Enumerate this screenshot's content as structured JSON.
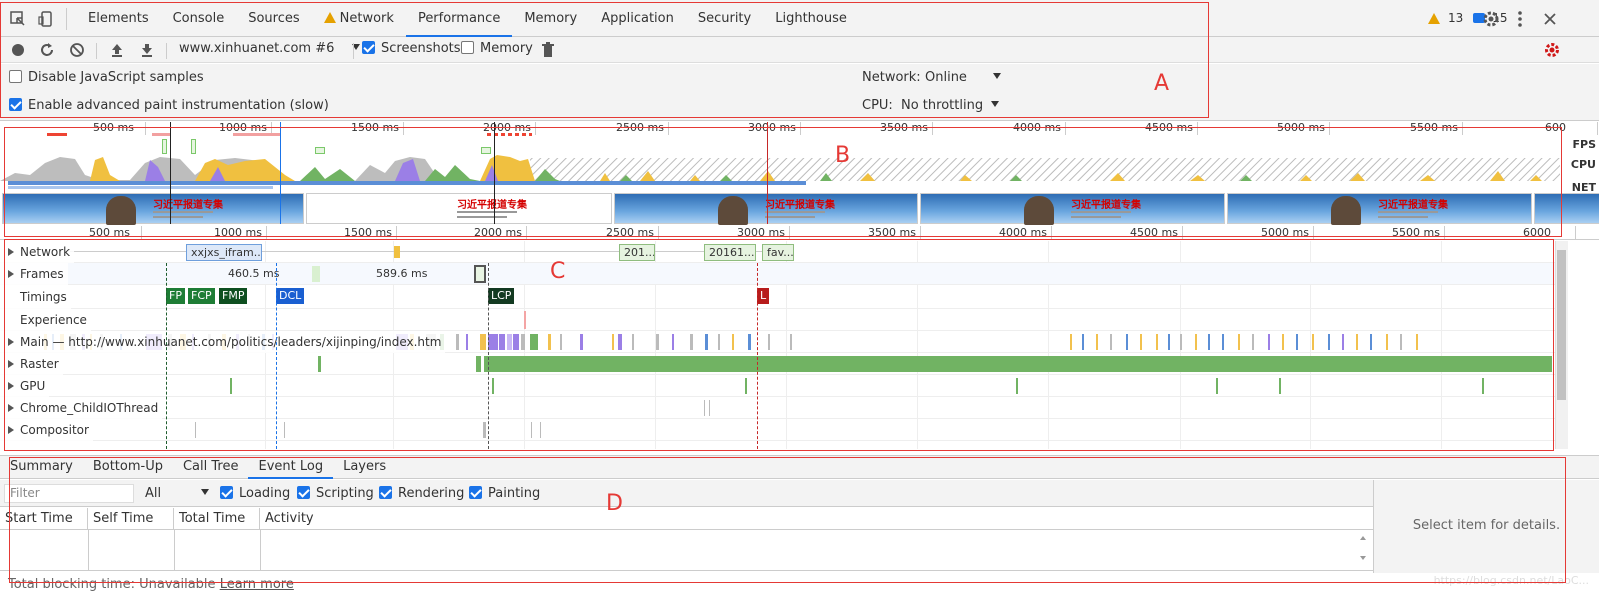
{
  "tabs": [
    {
      "label": "Elements"
    },
    {
      "label": "Console"
    },
    {
      "label": "Sources"
    },
    {
      "label": "Network",
      "warning": true
    },
    {
      "label": "Performance",
      "active": true
    },
    {
      "label": "Memory"
    },
    {
      "label": "Application"
    },
    {
      "label": "Security"
    },
    {
      "label": "Lighthouse"
    }
  ],
  "badges": {
    "warnings": "13",
    "messages": "15"
  },
  "toolbar": {
    "profile_select": "www.xinhuanet.com #6",
    "screenshots_label": "Screenshots",
    "screenshots_checked": true,
    "memory_label": "Memory",
    "memory_checked": false
  },
  "settings": {
    "disable_js_samples": "Disable JavaScript samples",
    "enable_paint": "Enable advanced paint instrumentation (slow)",
    "network_label": "Network:",
    "network_value": "Online",
    "cpu_label": "CPU:",
    "cpu_value": "No throttling"
  },
  "overview": {
    "ruler_top": [
      "500 ms",
      "1000 ms",
      "1500 ms",
      "2000 ms",
      "2500 ms",
      "3000 ms",
      "3500 ms",
      "4000 ms",
      "4500 ms",
      "5000 ms",
      "5500 ms",
      "600"
    ],
    "ruler_bottom": [
      "500 ms",
      "1000 ms",
      "1500 ms",
      "2000 ms",
      "2500 ms",
      "3000 ms",
      "3500 ms",
      "4000 ms",
      "4500 ms",
      "5000 ms",
      "5500 ms",
      "6000"
    ],
    "side_labels": [
      "FPS",
      "CPU",
      "NET"
    ],
    "screenshot_caption": "习近平报道专集"
  },
  "tracks": {
    "network": "Network",
    "frames": "Frames",
    "timings": "Timings",
    "experience": "Experience",
    "main": "Main — http://www.xinhuanet.com/politics/leaders/xijinping/index.htm",
    "raster": "Raster",
    "gpu": "GPU",
    "childio": "Chrome_ChildIOThread",
    "compositor": "Compositor"
  },
  "network_requests": [
    "xxjxs_ifram...",
    "201...",
    "20161...",
    "fav..."
  ],
  "frame_times": [
    "460.5 ms",
    "589.6 ms"
  ],
  "timing_markers": [
    "FP",
    "FCP",
    "FMP",
    "DCL",
    "LCP",
    "L"
  ],
  "bottom_tabs": [
    {
      "label": "Summary"
    },
    {
      "label": "Bottom-Up"
    },
    {
      "label": "Call Tree"
    },
    {
      "label": "Event Log",
      "active": true
    },
    {
      "label": "Layers"
    }
  ],
  "event_log": {
    "filter_placeholder": "Filter",
    "filter_select": "All",
    "loading": "Loading",
    "scripting": "Scripting",
    "rendering": "Rendering",
    "painting": "Painting",
    "columns": [
      "Start Time",
      "Self Time",
      "Total Time",
      "Activity"
    ]
  },
  "details_text": "Select item for details.",
  "footer": {
    "tbt": "Total blocking time: Unavailable",
    "learn_more": "Learn more"
  },
  "watermark": "https://blog.csdn.net/LaoC...",
  "annotations": [
    "A",
    "B",
    "C",
    "D"
  ],
  "colors": {
    "accent": "#1a73e8",
    "scripting": "#f2c14e",
    "rendering": "#9b7fe6",
    "painting": "#71b363",
    "loading": "#5b8ed6"
  }
}
